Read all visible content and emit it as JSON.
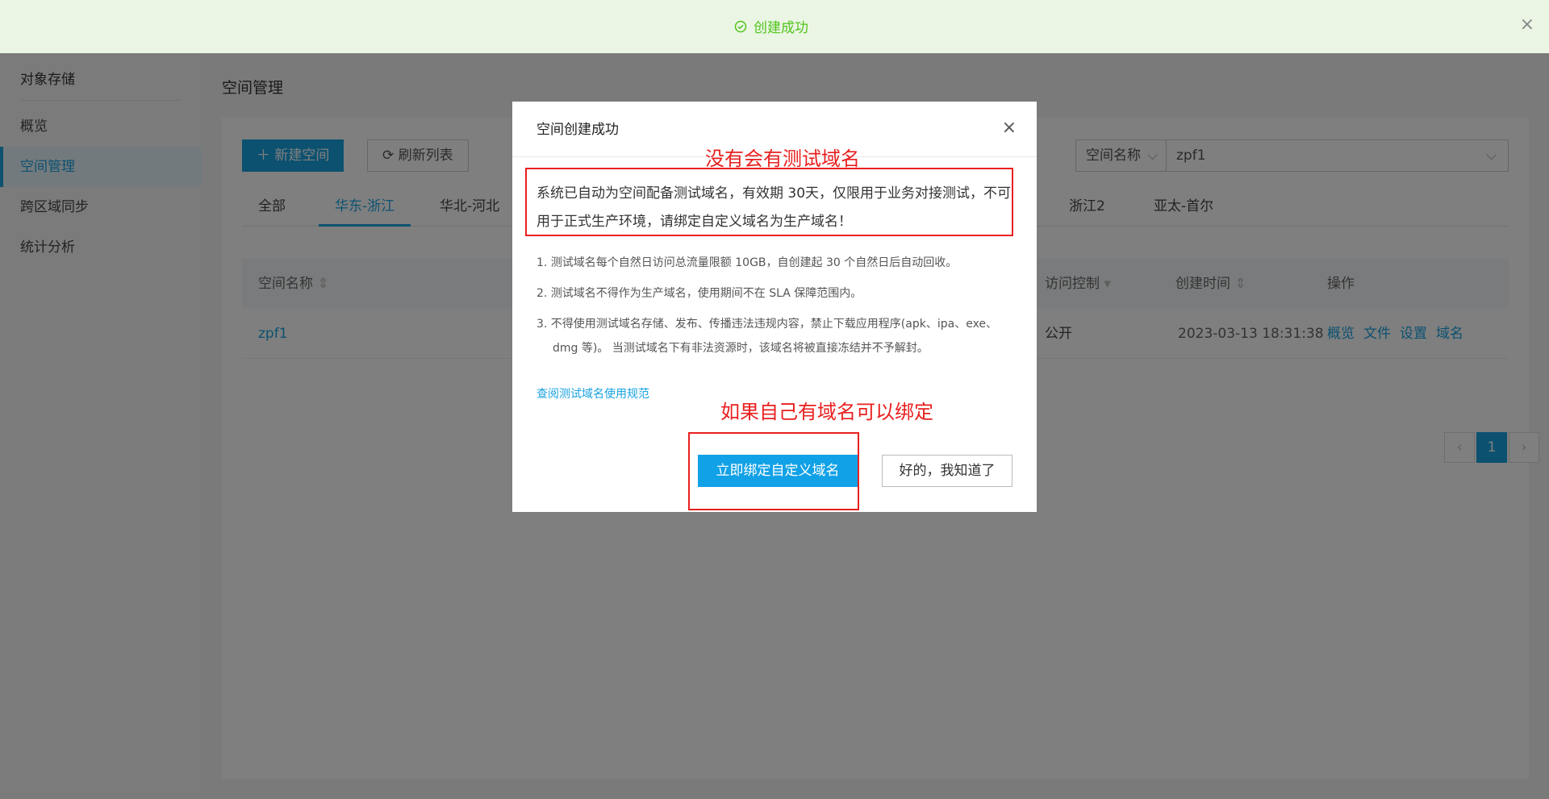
{
  "toast": {
    "message": "创建成功",
    "close": "×"
  },
  "sidebar": {
    "title": "对象存储",
    "items": [
      {
        "label": "概览"
      },
      {
        "label": "空间管理"
      },
      {
        "label": "跨区域同步"
      },
      {
        "label": "统计分析"
      }
    ]
  },
  "main": {
    "page_title": "空间管理",
    "new_button": "新建空间",
    "refresh_button": "刷新列表",
    "tabs": [
      "全部",
      "华东-浙江",
      "华北-河北",
      "浙江2",
      "亚太-首尔"
    ],
    "filter": {
      "field": "空间名称",
      "value": "zpf1"
    },
    "table": {
      "headers": [
        "空间名称",
        "访问控制",
        "创建时间",
        "操作"
      ],
      "row": {
        "name": "zpf1",
        "access": "公开",
        "created": "2023-03-13 18:31:38",
        "actions": [
          "概览",
          "文件",
          "设置",
          "域名"
        ]
      }
    },
    "pager": {
      "current": "1",
      "prev": "‹",
      "next": "›"
    }
  },
  "modal": {
    "title": "空间创建成功",
    "close": "×",
    "notice": "系统已自动为空间配备测试域名，有效期 30天，仅限用于业务对接测试，不可用于正式生产环境，请绑定自定义域名为生产域名！",
    "list": [
      "1. 测试域名每个自然日访问总流量限额  10GB，自创建起  30  个自然日后自动回收。",
      "2. 测试域名不得作为生产域名，使用期间不在 SLA 保障范围内。",
      "3. 不得使用测试域名存储、发布、传播违法违规内容，禁止下载应用程序(apk、ipa、exe、dmg 等)。 当测试域名下有非法资源时，该域名将被直接冻结并不予解封。"
    ],
    "doc_link": "查阅测试域名使用规范",
    "bind_button": "立即绑定自定义域名",
    "ok_button": "好的，我知道了"
  },
  "annotations": {
    "top": "没有会有测试域名",
    "bottom": "如果自己有域名可以绑定",
    "color": "#e8201f"
  },
  "colors": {
    "accent": "#19a3e0",
    "success": "#52c41a",
    "annotation": "#e8201f"
  }
}
